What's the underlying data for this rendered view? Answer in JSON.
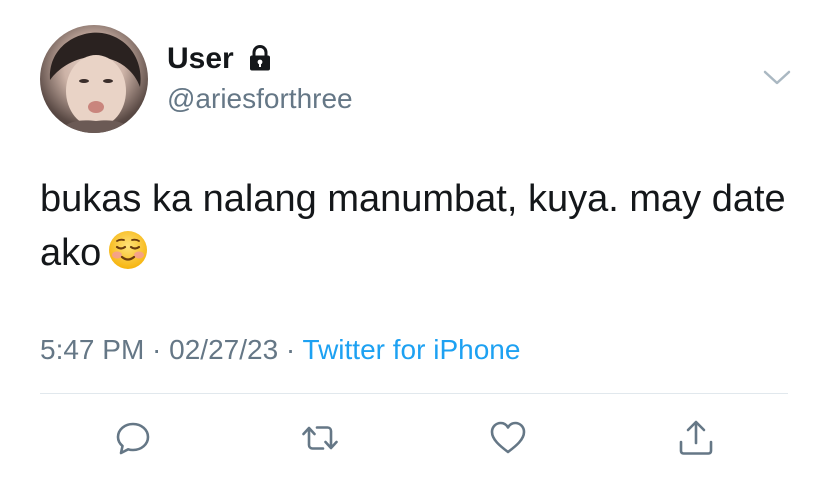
{
  "tweet": {
    "author": {
      "display_name": "User",
      "handle": "@ariesforthree",
      "protected_icon": "lock-icon"
    },
    "text": "bukas ka nalang manumbat, kuya. may date ako",
    "emoji": "smiling-face-emoji",
    "timestamp": "5:47 PM · 02/27/23 · ",
    "source": "Twitter for iPhone",
    "menu_icon": "chevron-down-icon",
    "actions": [
      {
        "name": "reply",
        "icon": "reply-icon"
      },
      {
        "name": "retweet",
        "icon": "retweet-icon"
      },
      {
        "name": "like",
        "icon": "heart-icon"
      },
      {
        "name": "share",
        "icon": "share-icon"
      }
    ],
    "colors": {
      "text": "#14171a",
      "secondary": "#657786",
      "link": "#1da1f2",
      "divider": "#e1e8ed"
    }
  }
}
